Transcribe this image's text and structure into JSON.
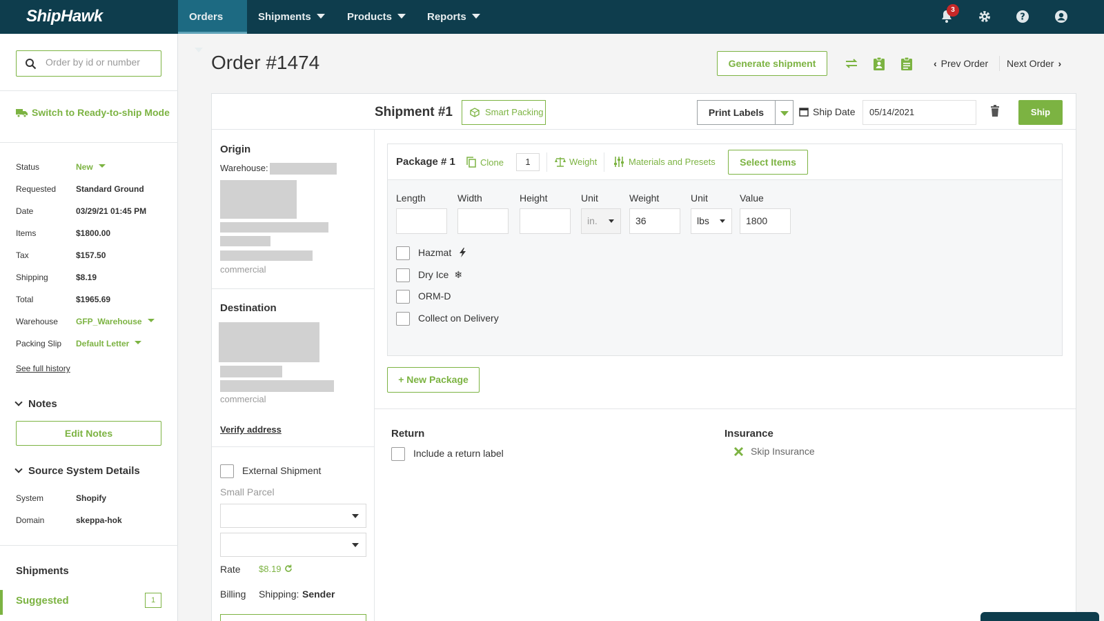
{
  "brand": "ShipHawk",
  "nav": {
    "orders": "Orders",
    "shipments": "Shipments",
    "products": "Products",
    "reports": "Reports",
    "notification_count": "3"
  },
  "sidebar": {
    "search_placeholder": "Order by id or number",
    "ready_to_ship": "Switch to Ready-to-ship Mode",
    "summary": [
      {
        "label": "Status",
        "value": "New"
      },
      {
        "label": "Requested",
        "value": "Standard Ground"
      },
      {
        "label": "Date",
        "value": "03/29/21 01:45 PM"
      },
      {
        "label": "Items",
        "value": "$1800.00"
      },
      {
        "label": "Tax",
        "value": "$157.50"
      },
      {
        "label": "Shipping",
        "value": "$8.19"
      },
      {
        "label": "Total",
        "value": "$1965.69"
      },
      {
        "label": "Warehouse",
        "value": "GFP_Warehouse"
      },
      {
        "label": "Packing Slip",
        "value": "Default Letter"
      }
    ],
    "see_history": "See full history",
    "notes_heading": "Notes",
    "edit_notes": "Edit Notes",
    "source_heading": "Source System Details",
    "source": [
      {
        "label": "System",
        "value": "Shopify"
      },
      {
        "label": "Domain",
        "value": "skeppa-hok"
      }
    ],
    "shipments_heading": "Shipments",
    "suggested_label": "Suggested",
    "suggested_count": "1"
  },
  "order": {
    "title": "Order #1474",
    "generate_shipment": "Generate shipment",
    "prev_order": "Prev Order",
    "next_order": "Next Order"
  },
  "shipment": {
    "title": "Shipment #1",
    "smart_packing": "Smart Packing",
    "print_labels": "Print Labels",
    "ship_date_label": "Ship Date",
    "ship_date": "05/14/2021",
    "ship_button": "Ship",
    "origin_heading": "Origin",
    "warehouse_label": "Warehouse:",
    "origin_type": "commercial",
    "destination_heading": "Destination",
    "destination_type": "commercial",
    "verify_address": "Verify address",
    "external_shipment": "External Shipment",
    "small_parcel": "Small Parcel",
    "rate_label": "Rate",
    "rate_value": "$8.19",
    "billing_label": "Billing",
    "billing_prefix": "Shipping:",
    "billing_value": "Sender"
  },
  "package": {
    "title": "Package # 1",
    "clone": "Clone",
    "quantity": "1",
    "weight_tool": "Weight",
    "materials": "Materials and Presets",
    "select_items": "Select Items",
    "fields": {
      "length_label": "Length",
      "length": "",
      "width_label": "Width",
      "width": "",
      "height_label": "Height",
      "height": "",
      "unit_label": "Unit",
      "dim_unit": "in.",
      "weight_label": "Weight",
      "weight": "36",
      "weight_unit_label": "Unit",
      "weight_unit": "lbs",
      "value_label": "Value",
      "value": "1800"
    },
    "checkboxes": [
      "Hazmat",
      "Dry Ice",
      "ORM-D",
      "Collect on Delivery"
    ],
    "new_package": "+ New Package"
  },
  "return_section": {
    "heading": "Return",
    "include_label": "Include a return label"
  },
  "insurance": {
    "heading": "Insurance",
    "skip": "Skip Insurance"
  },
  "colors": {
    "nav_bg": "#0e3d4d",
    "accent": "#7cb342",
    "active_tab": "#1d6a82",
    "badge": "#c62828"
  }
}
